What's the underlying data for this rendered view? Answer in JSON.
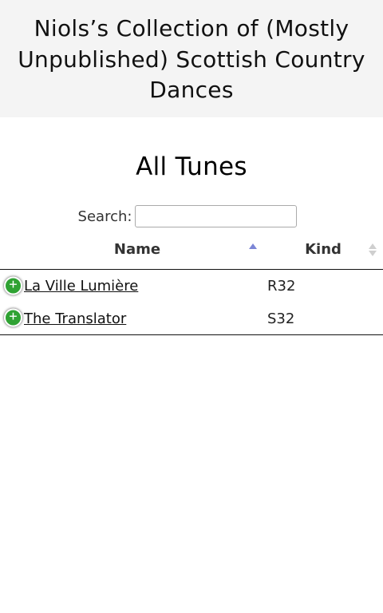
{
  "header": {
    "title": "Niols’s Collection of (Mostly Unpublished) Scottish Country Dances"
  },
  "page": {
    "heading": "All Tunes"
  },
  "search": {
    "label": "Search:",
    "value": ""
  },
  "table": {
    "columns": {
      "name": "Name",
      "kind": "Kind"
    },
    "sort": {
      "column": "Name",
      "direction": "ascending"
    },
    "rows": [
      {
        "name": "La Ville Lumière",
        "kind": "R32"
      },
      {
        "name": "The Translator",
        "kind": "S32"
      }
    ],
    "expand_icon_glyph": "+"
  },
  "colors": {
    "header_bg": "#f4f4f4",
    "expand_button": "#2fa233",
    "sort_active": "#7c86d6",
    "sort_inactive": "#cfcfcf"
  },
  "icons": {
    "expand": "plus-circle-icon",
    "sort_active": "sort-ascending-icon",
    "sort_inactive": "sort-both-icon"
  }
}
